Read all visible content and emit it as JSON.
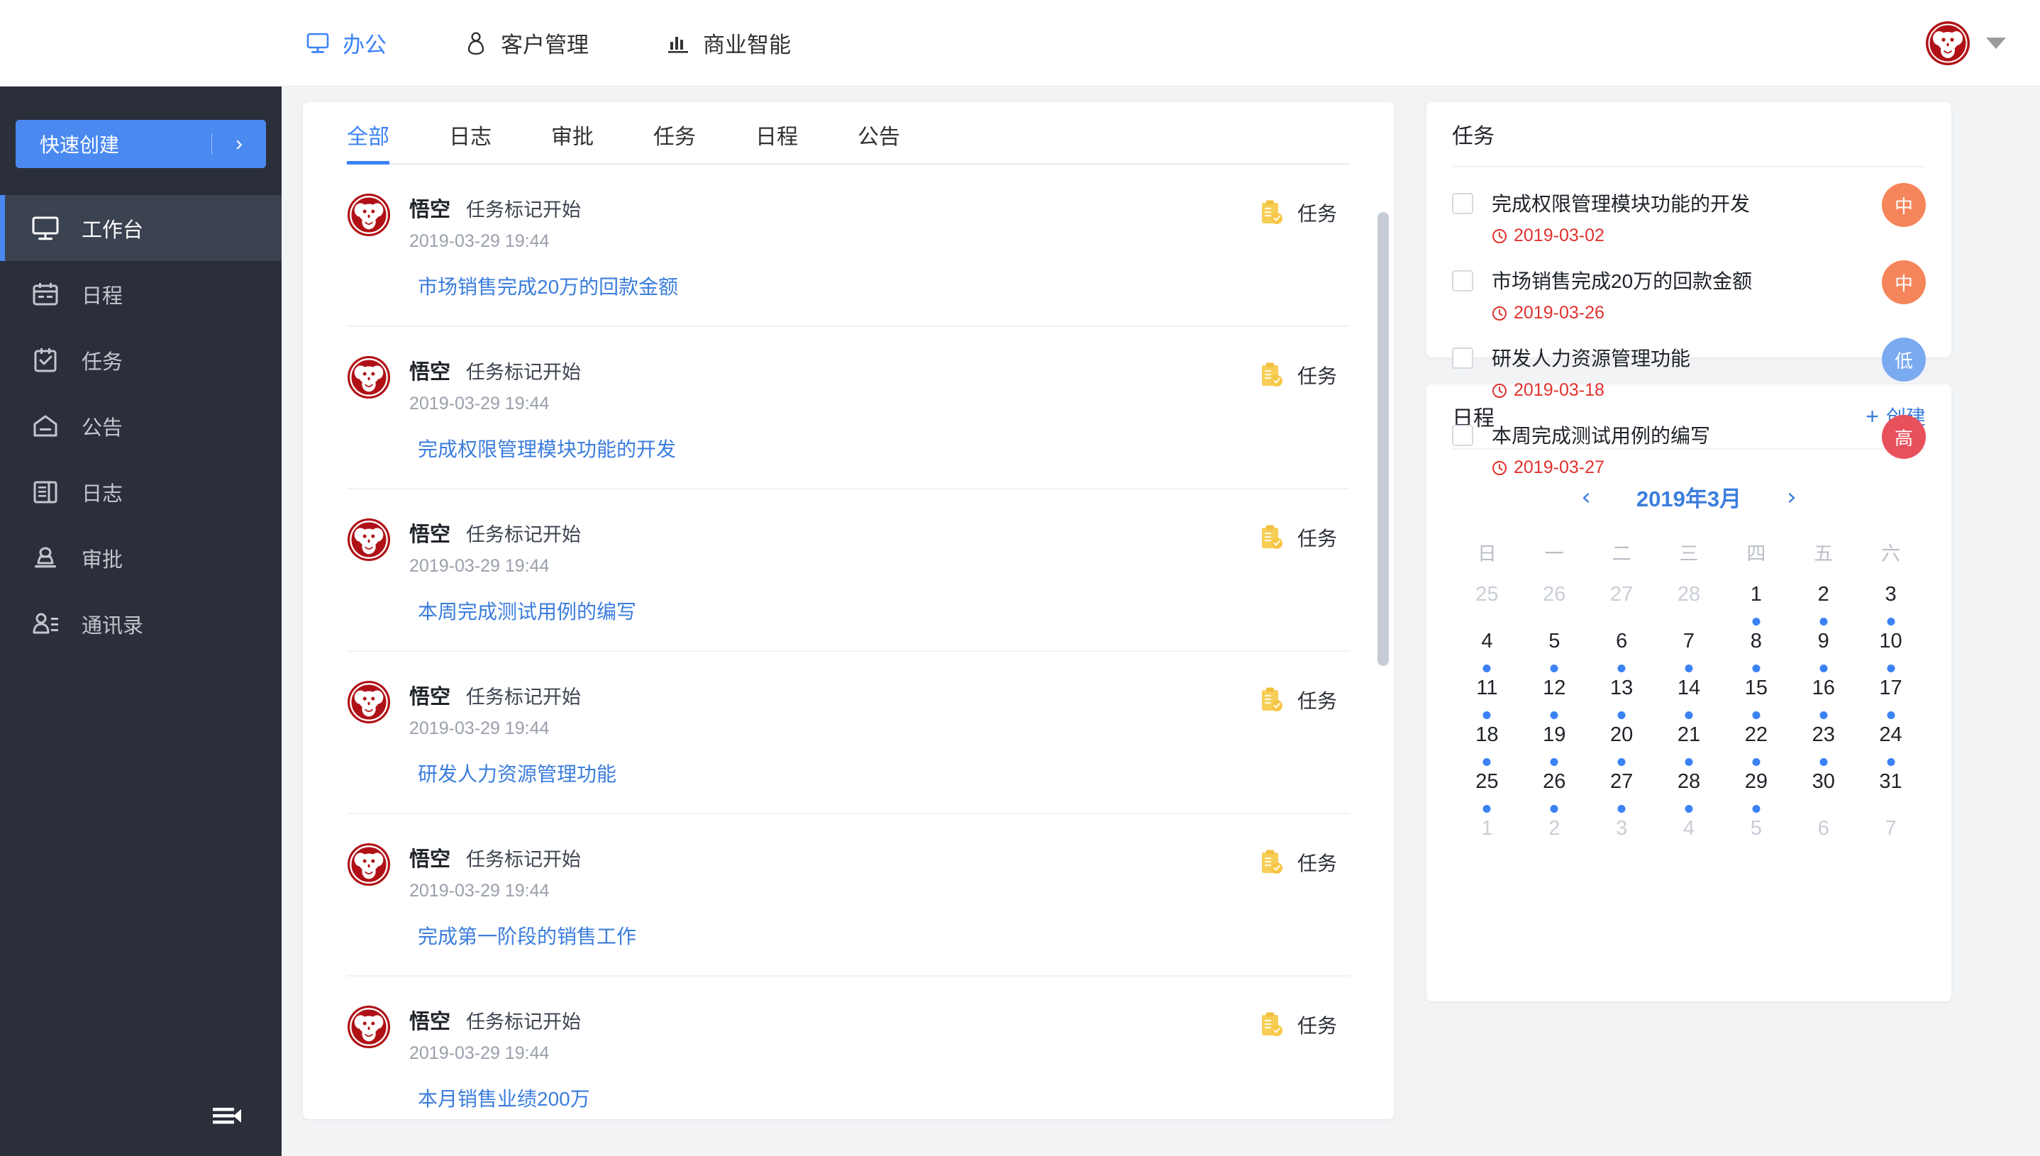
{
  "topbar": {
    "nav": [
      {
        "label": "办公",
        "icon": "monitor-icon",
        "active": true
      },
      {
        "label": "客户管理",
        "icon": "user-icon",
        "active": false
      },
      {
        "label": "商业智能",
        "icon": "bar-chart-icon",
        "active": false
      }
    ],
    "avatar": "monkey-avatar",
    "caret": "chevron-down-icon"
  },
  "sidebar": {
    "quick_create": {
      "label": "快速创建",
      "arrow": "›"
    },
    "items": [
      {
        "label": "工作台",
        "icon": "workbench-icon",
        "active": true
      },
      {
        "label": "日程",
        "icon": "calendar-icon",
        "active": false
      },
      {
        "label": "任务",
        "icon": "task-icon",
        "active": false
      },
      {
        "label": "公告",
        "icon": "announcement-icon",
        "active": false
      },
      {
        "label": "日志",
        "icon": "journal-icon",
        "active": false
      },
      {
        "label": "审批",
        "icon": "approval-icon",
        "active": false
      },
      {
        "label": "通讯录",
        "icon": "contacts-icon",
        "active": false
      }
    ],
    "collapse": "collapse-sidebar-icon"
  },
  "feed": {
    "tabs": [
      {
        "label": "全部",
        "active": true
      },
      {
        "label": "日志",
        "active": false
      },
      {
        "label": "审批",
        "active": false
      },
      {
        "label": "任务",
        "active": false
      },
      {
        "label": "日程",
        "active": false
      },
      {
        "label": "公告",
        "active": false
      }
    ],
    "items": [
      {
        "name": "悟空",
        "action": "任务标记开始",
        "time": "2019-03-29 19:44",
        "link": "市场销售完成20万的回款金额",
        "type": "任务"
      },
      {
        "name": "悟空",
        "action": "任务标记开始",
        "time": "2019-03-29 19:44",
        "link": "完成权限管理模块功能的开发",
        "type": "任务"
      },
      {
        "name": "悟空",
        "action": "任务标记开始",
        "time": "2019-03-29 19:44",
        "link": "本周完成测试用例的编写",
        "type": "任务"
      },
      {
        "name": "悟空",
        "action": "任务标记开始",
        "time": "2019-03-29 19:44",
        "link": "研发人力资源管理功能",
        "type": "任务"
      },
      {
        "name": "悟空",
        "action": "任务标记开始",
        "time": "2019-03-29 19:44",
        "link": "完成第一阶段的销售工作",
        "type": "任务"
      },
      {
        "name": "悟空",
        "action": "任务标记开始",
        "time": "2019-03-29 19:44",
        "link": "本月销售业绩200万",
        "type": "任务"
      }
    ]
  },
  "tasks": {
    "title": "任务",
    "items": [
      {
        "title": "完成权限管理模块功能的开发",
        "due": "2019-03-02",
        "priority": "中",
        "priority_color": "#f5855a"
      },
      {
        "title": "市场销售完成20万的回款金额",
        "due": "2019-03-26",
        "priority": "中",
        "priority_color": "#f5855a"
      },
      {
        "title": "研发人力资源管理功能",
        "due": "2019-03-18",
        "priority": "低",
        "priority_color": "#7aaaf0"
      },
      {
        "title": "本周完成测试用例的编写",
        "due": "2019-03-27",
        "priority": "高",
        "priority_color": "#e8505b"
      }
    ]
  },
  "calendar": {
    "title": "日程",
    "create_label": "创建",
    "prev": "‹",
    "next": "›",
    "month_label": "2019年3月",
    "weekdays": [
      "日",
      "一",
      "二",
      "三",
      "四",
      "五",
      "六"
    ],
    "days": [
      {
        "n": "25",
        "muted": true,
        "dot": false
      },
      {
        "n": "26",
        "muted": true,
        "dot": false
      },
      {
        "n": "27",
        "muted": true,
        "dot": false
      },
      {
        "n": "28",
        "muted": true,
        "dot": false
      },
      {
        "n": "1",
        "muted": false,
        "dot": true
      },
      {
        "n": "2",
        "muted": false,
        "dot": true
      },
      {
        "n": "3",
        "muted": false,
        "dot": true
      },
      {
        "n": "4",
        "muted": false,
        "dot": true
      },
      {
        "n": "5",
        "muted": false,
        "dot": true
      },
      {
        "n": "6",
        "muted": false,
        "dot": true
      },
      {
        "n": "7",
        "muted": false,
        "dot": true
      },
      {
        "n": "8",
        "muted": false,
        "dot": true
      },
      {
        "n": "9",
        "muted": false,
        "dot": true
      },
      {
        "n": "10",
        "muted": false,
        "dot": true
      },
      {
        "n": "11",
        "muted": false,
        "dot": true
      },
      {
        "n": "12",
        "muted": false,
        "dot": true
      },
      {
        "n": "13",
        "muted": false,
        "dot": true
      },
      {
        "n": "14",
        "muted": false,
        "dot": true
      },
      {
        "n": "15",
        "muted": false,
        "dot": true
      },
      {
        "n": "16",
        "muted": false,
        "dot": true
      },
      {
        "n": "17",
        "muted": false,
        "dot": true
      },
      {
        "n": "18",
        "muted": false,
        "dot": true
      },
      {
        "n": "19",
        "muted": false,
        "dot": true
      },
      {
        "n": "20",
        "muted": false,
        "dot": true
      },
      {
        "n": "21",
        "muted": false,
        "dot": true
      },
      {
        "n": "22",
        "muted": false,
        "dot": true
      },
      {
        "n": "23",
        "muted": false,
        "dot": true
      },
      {
        "n": "24",
        "muted": false,
        "dot": true
      },
      {
        "n": "25",
        "muted": false,
        "dot": true
      },
      {
        "n": "26",
        "muted": false,
        "dot": true
      },
      {
        "n": "27",
        "muted": false,
        "dot": true
      },
      {
        "n": "28",
        "muted": false,
        "dot": true
      },
      {
        "n": "29",
        "muted": false,
        "dot": true
      },
      {
        "n": "30",
        "muted": false,
        "dot": false
      },
      {
        "n": "31",
        "muted": false,
        "dot": false
      },
      {
        "n": "1",
        "muted": true,
        "dot": false
      },
      {
        "n": "2",
        "muted": true,
        "dot": false
      },
      {
        "n": "3",
        "muted": true,
        "dot": false
      },
      {
        "n": "4",
        "muted": true,
        "dot": false
      },
      {
        "n": "5",
        "muted": true,
        "dot": false
      },
      {
        "n": "6",
        "muted": true,
        "dot": false
      },
      {
        "n": "7",
        "muted": true,
        "dot": false
      }
    ]
  },
  "colors": {
    "accent_blue": "#3b82f6",
    "link_blue": "#3b7ddd",
    "sidebar_bg": "#2b2f3a",
    "page_bg": "#f2f3f5",
    "brand_red": "#b01116",
    "task_yellow": "#f7ce56",
    "due_red": "#e0332f"
  }
}
